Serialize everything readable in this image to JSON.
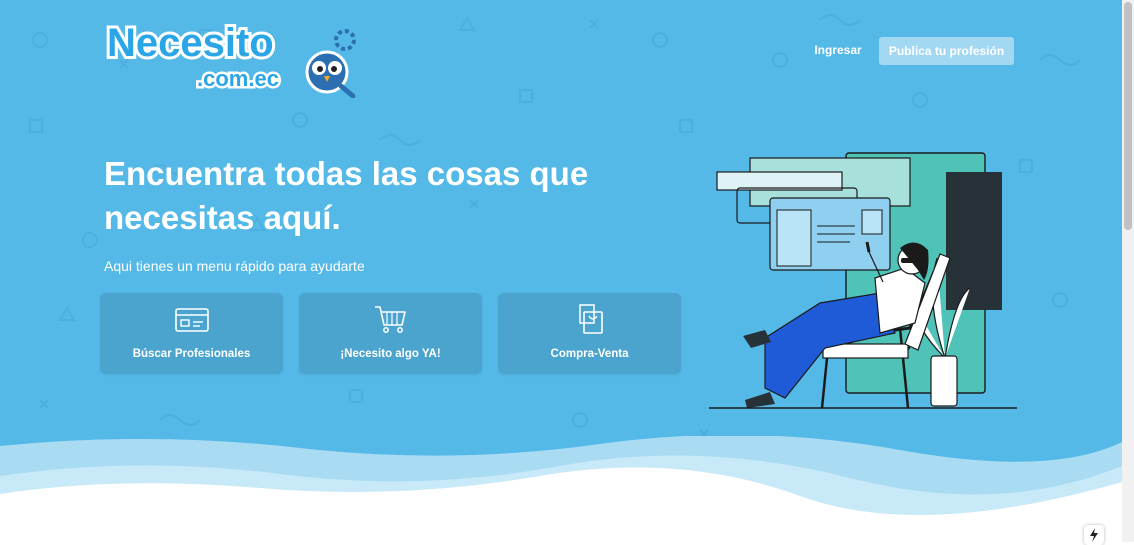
{
  "brand": {
    "logo_text": "Necesito",
    "logo_domain": ".com.ec"
  },
  "nav": {
    "login_label": "Ingresar",
    "publish_label": "Publica tu profesión"
  },
  "hero": {
    "title": "Encuentra todas las cosas que necesitas aquí.",
    "subtitle": "Aqui tienes un menu rápido para ayudarte"
  },
  "menu": [
    {
      "label": "Búscar Profesionales",
      "icon": "id-card-icon"
    },
    {
      "label": "¡Necesito algo YA!",
      "icon": "shopping-cart-icon"
    },
    {
      "label": "Compra-Venta",
      "icon": "shopping-bag-icon"
    }
  ],
  "colors": {
    "hero_bg": "#55b9e8",
    "card_bg": "#4aa4ce",
    "publish_btn_bg": "#a3d8f3",
    "illustration_teal": "#4fc3b8",
    "illustration_blue": "#1f5bd6"
  }
}
